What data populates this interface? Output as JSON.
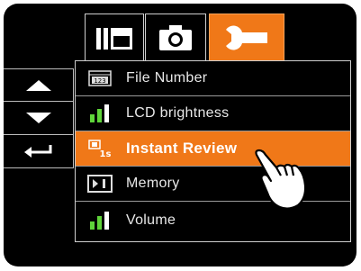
{
  "tabs": [
    {
      "name": "display-mode",
      "icon": "display-mode-icon"
    },
    {
      "name": "camera",
      "icon": "camera-icon"
    },
    {
      "name": "settings",
      "icon": "wrench-icon",
      "active": true
    }
  ],
  "menu": {
    "items": [
      {
        "label": "File Number",
        "icon": "file-number-icon"
      },
      {
        "label": "LCD brightness",
        "icon": "signal-bars-icon"
      },
      {
        "label": "Instant Review",
        "icon": "instant-review-icon",
        "selected": true
      },
      {
        "label": "Memory",
        "icon": "memory-card-icon"
      },
      {
        "label": "Volume",
        "icon": "signal-bars-icon"
      }
    ]
  },
  "nav": {
    "up_icon": "arrow-up-icon",
    "down_icon": "arrow-down-icon",
    "back_icon": "return-arrow-icon"
  },
  "colors": {
    "accent": "#f07818",
    "background": "#000000",
    "green_bar": "#5fd43a",
    "text": "#e8e8e8"
  }
}
